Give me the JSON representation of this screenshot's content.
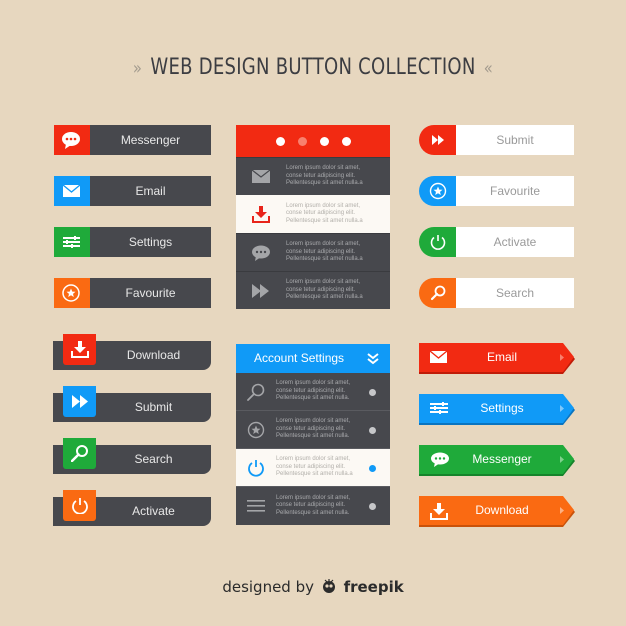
{
  "header": {
    "title": "WEB DESIGN BUTTON COLLECTION",
    "left_decor": "»",
    "right_decor": "«"
  },
  "colors": {
    "background": "#e7d7bf",
    "dark": "#47484d",
    "red": "#f22a12",
    "blue": "#109af7",
    "green": "#1faa3a",
    "orange": "#fa6a12",
    "light": "#fcf9f4"
  },
  "tag_buttons": [
    {
      "label": "Messenger",
      "icon": "chat-bubble-icon",
      "color": "#f22a12"
    },
    {
      "label": "Email",
      "icon": "envelope-icon",
      "color": "#109af7"
    },
    {
      "label": "Settings",
      "icon": "sliders-icon",
      "color": "#1faa3a"
    },
    {
      "label": "Favourite",
      "icon": "star-circle-icon",
      "color": "#fa6a12"
    }
  ],
  "fold_buttons": [
    {
      "label": "Download",
      "icon": "download-icon",
      "color": "#f22a12"
    },
    {
      "label": "Submit",
      "icon": "fast-forward-icon",
      "color": "#109af7"
    },
    {
      "label": "Search",
      "icon": "search-icon",
      "color": "#1faa3a"
    },
    {
      "label": "Activate",
      "icon": "power-icon",
      "color": "#fa6a12"
    }
  ],
  "panel_top": {
    "pager": {
      "count": 4,
      "active_index": 1
    },
    "rows": [
      {
        "icon": "envelope-icon",
        "lines": [
          "Lorem ipsum dolor sit amet,",
          "conse tetur adipiscing elit.",
          "Pellentesque sit amet nulla.a"
        ],
        "selected": false
      },
      {
        "icon": "download-icon",
        "lines": [
          "Lorem ipsum dolor sit amet,",
          "conse tetur adipiscing elit.",
          "Pellentesque sit amet nulla.a"
        ],
        "selected": true
      },
      {
        "icon": "chat-bubble-icon",
        "lines": [
          "Lorem ipsum dolor sit amet,",
          "conse tetur adipiscing elit.",
          "Pellentesque sit amet nulla.a"
        ],
        "selected": false
      },
      {
        "icon": "fast-forward-icon",
        "lines": [
          "Lorem ipsum dolor sit amet,",
          "conse tetur adipiscing elit.",
          "Pellentesque sit amet nulla.a"
        ],
        "selected": false
      }
    ]
  },
  "panel_account": {
    "title": "Account Settings",
    "rows": [
      {
        "icon": "search-icon",
        "lines": [
          "Lorem ipsum dolor sit amet,",
          "conse tetur adipiscing elit.",
          "Pellentesque sit amet nulla."
        ],
        "selected": false
      },
      {
        "icon": "star-circle-icon",
        "lines": [
          "Lorem ipsum dolor sit amet,",
          "conse tetur adipiscing elit.",
          "Pellentesque sit amet nulla."
        ],
        "selected": false
      },
      {
        "icon": "power-icon",
        "lines": [
          "Lorem ipsum dolor sit amet,",
          "conse tetur adipiscing elit.",
          "Pellentesque sit amet nulla.a"
        ],
        "selected": true
      },
      {
        "icon": "menu-icon",
        "lines": [
          "Lorem ipsum dolor sit amet,",
          "conse tetur adipiscing elit.",
          "Pellentesque sit amet nulla."
        ],
        "selected": false
      }
    ]
  },
  "pill_buttons": [
    {
      "label": "Submit",
      "icon": "fast-forward-icon",
      "color": "#f22a12"
    },
    {
      "label": "Favourite",
      "icon": "star-circle-icon",
      "color": "#109af7"
    },
    {
      "label": "Activate",
      "icon": "power-icon",
      "color": "#1faa3a"
    },
    {
      "label": "Search",
      "icon": "search-icon",
      "color": "#fa6a12"
    }
  ],
  "arrow_buttons": [
    {
      "label": "Email",
      "icon": "envelope-icon",
      "color": "#f22a12",
      "shade": "#c01c08"
    },
    {
      "label": "Settings",
      "icon": "sliders-icon",
      "color": "#109af7",
      "shade": "#0a74c0"
    },
    {
      "label": "Messenger",
      "icon": "chat-bubble-icon",
      "color": "#1faa3a",
      "shade": "#16842b"
    },
    {
      "label": "Download",
      "icon": "download-icon",
      "color": "#fa6a12",
      "shade": "#c9520a"
    }
  ],
  "credit": {
    "prefix": "designed by",
    "brand": "freepik"
  }
}
